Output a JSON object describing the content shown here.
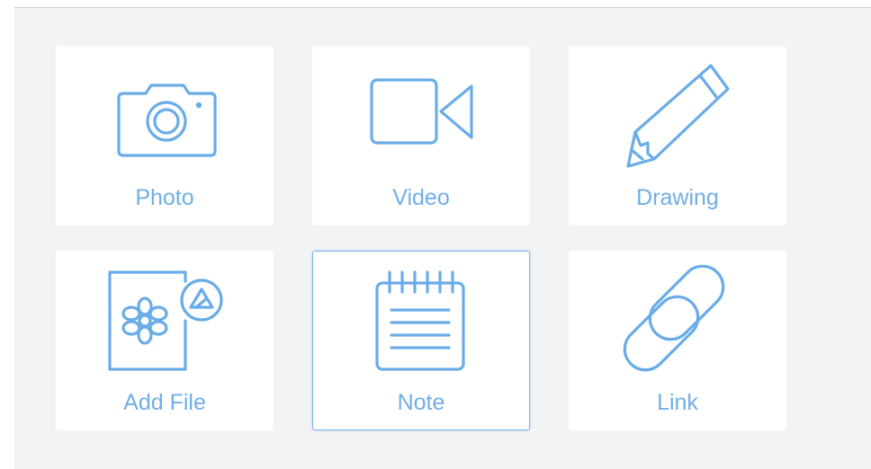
{
  "options": [
    {
      "id": "photo",
      "label": "Photo",
      "icon": "camera-icon"
    },
    {
      "id": "video",
      "label": "Video",
      "icon": "video-camera-icon"
    },
    {
      "id": "drawing",
      "label": "Drawing",
      "icon": "pencil-icon"
    },
    {
      "id": "file",
      "label": "Add File",
      "icon": "file-with-drive-icon"
    },
    {
      "id": "note",
      "label": "Note",
      "icon": "notepad-icon",
      "selected": true
    },
    {
      "id": "link",
      "label": "Link",
      "icon": "link-chain-icon"
    }
  ],
  "colors": {
    "accent": "#6aace8",
    "background": "#f2f3f4",
    "tile": "#ffffff",
    "selected_border": "#7db3e6"
  }
}
